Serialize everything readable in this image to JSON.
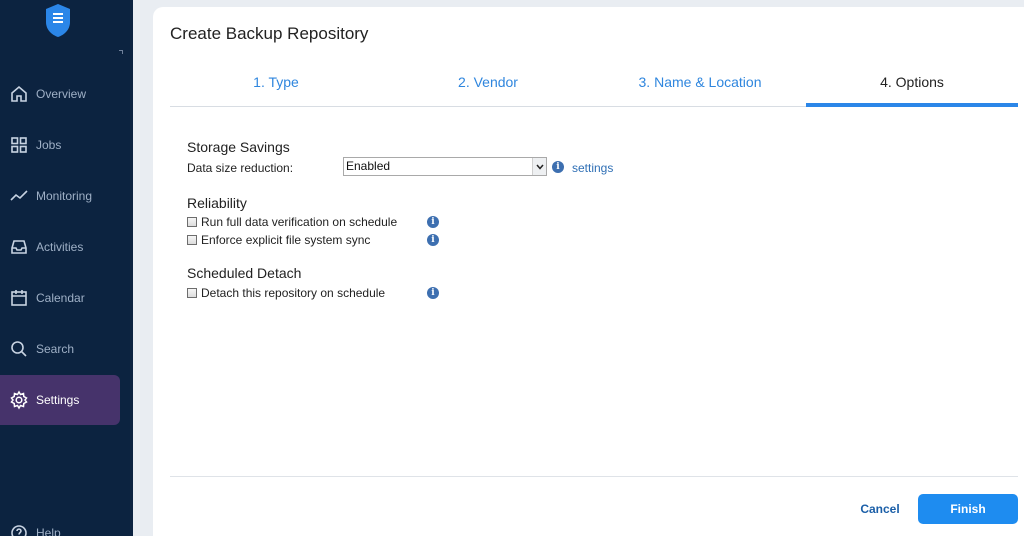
{
  "sidebar": {
    "items": [
      {
        "label": "Overview",
        "icon": "home-icon"
      },
      {
        "label": "Jobs",
        "icon": "grid-icon"
      },
      {
        "label": "Monitoring",
        "icon": "chart-line-icon"
      },
      {
        "label": "Activities",
        "icon": "inbox-icon"
      },
      {
        "label": "Calendar",
        "icon": "calendar-icon"
      },
      {
        "label": "Search",
        "icon": "search-icon"
      },
      {
        "label": "Settings",
        "icon": "gear-icon"
      },
      {
        "label": "Help",
        "icon": "help-icon"
      }
    ],
    "active_item": "Settings"
  },
  "dialog": {
    "title": "Create Backup Repository",
    "steps": [
      "1. Type",
      "2. Vendor",
      "3. Name & Location",
      "4. Options"
    ],
    "active_step": "4. Options",
    "storage_savings": {
      "title": "Storage Savings",
      "label": "Data size reduction:",
      "value": "Enabled",
      "settings_link": "settings"
    },
    "reliability": {
      "title": "Reliability",
      "options": [
        "Run full data verification on schedule",
        "Enforce explicit file system sync"
      ]
    },
    "scheduled_detach": {
      "title": "Scheduled Detach",
      "option": "Detach this repository on schedule"
    },
    "buttons": {
      "cancel": "Cancel",
      "finish": "Finish"
    }
  },
  "colors": {
    "sidebar_bg": "#0c2340",
    "active_nav_bg": "#46336b",
    "accent": "#1e8cf0",
    "link": "#2f86de"
  }
}
